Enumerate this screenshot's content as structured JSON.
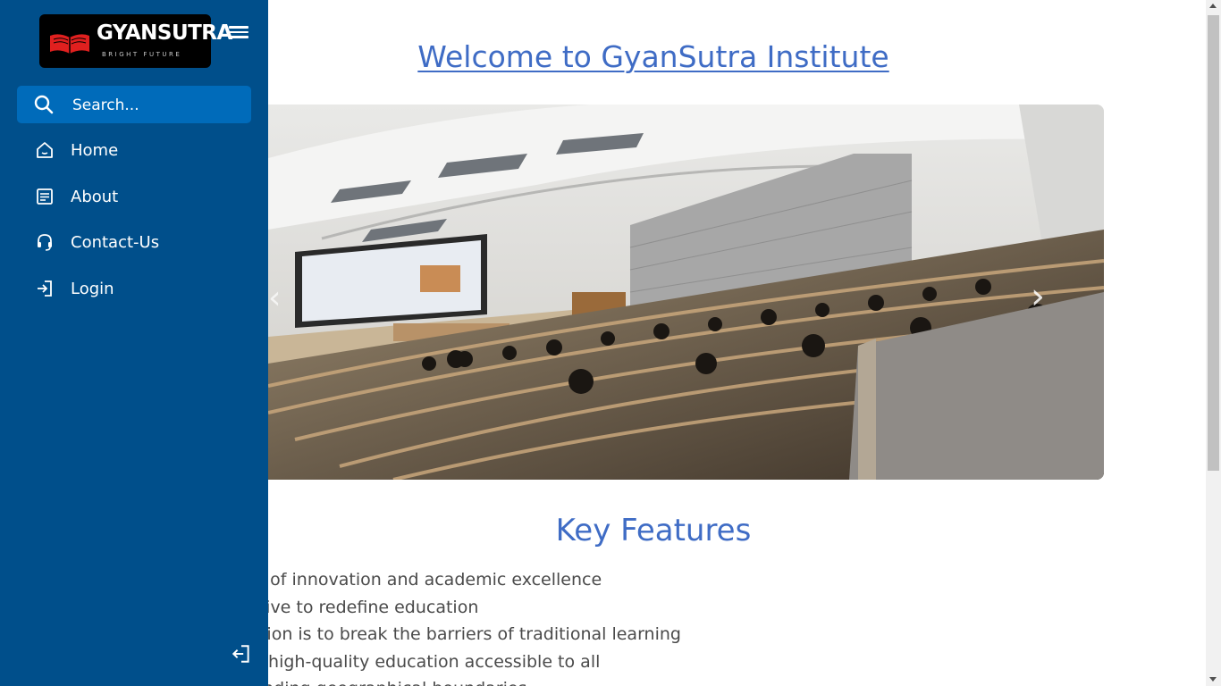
{
  "brand": {
    "name": "GYANSUTRA",
    "tagline": "BRIGHT FUTURE"
  },
  "sidebar": {
    "search_placeholder": "Search...",
    "items": [
      {
        "label": "Home",
        "icon": "home-icon"
      },
      {
        "label": "About",
        "icon": "document-icon"
      },
      {
        "label": "Contact-Us",
        "icon": "headset-icon"
      },
      {
        "label": "Login",
        "icon": "login-icon"
      }
    ],
    "footer_icon": "logout-icon"
  },
  "main": {
    "welcome_heading": "Welcome to GyanSutra Institute",
    "carousel": {
      "image_alt": "Lecture hall with students",
      "prev_icon": "chevron-left-icon",
      "next_icon": "chevron-right-icon"
    },
    "key_features_title": "Key Features",
    "features": [
      "ub of innovation and academic excellence",
      "strive to redefine education",
      " vision is to break the barriers of traditional learning",
      "ke high-quality education accessible to all",
      "cending geographical boundaries"
    ]
  },
  "colors": {
    "sidebar_bg": "#004f8b",
    "search_bg": "#006bba",
    "heading": "#3f6cc5"
  }
}
